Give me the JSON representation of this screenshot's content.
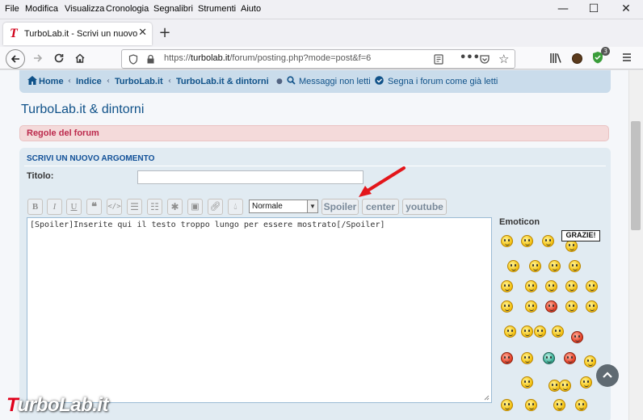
{
  "menu": {
    "items": [
      "File",
      "Modifica",
      "Visualizza",
      "Cronologia",
      "Segnalibri",
      "Strumenti",
      "Aiuto"
    ],
    "window_controls": {
      "minimize": "—",
      "maximize": "☐",
      "close": "✕"
    }
  },
  "tab": {
    "title": "TurboLab.it - Scrivi un nuovo a",
    "logo": "T",
    "close": "✕",
    "new_tab": "+"
  },
  "address": {
    "url_prefix": "https://",
    "url_domain": "turbolab.it",
    "url_path": "/forum/posting.php?mode=post&f=6",
    "badge_count": "3"
  },
  "breadcrumb": {
    "home": "Home",
    "index": "Indice",
    "turbolab": "TurboLab.it",
    "forum": "TurboLab.it & dintorni",
    "unread": "Messaggi non letti",
    "mark_read": "Segna i forum come già letti"
  },
  "forum_title": "TurboLab.it & dintorni",
  "rules_label": "Regole del forum",
  "post_form": {
    "heading": "SCRIVI UN NUOVO ARGOMENTO",
    "subject_label": "Titolo:",
    "subject_value": "",
    "font_size_selected": "Normale",
    "bbcode_spoiler": "Spoiler",
    "bbcode_center": "center",
    "bbcode_youtube": "youtube",
    "message_text": "[Spoiler]Inserite qui il testo troppo lungo per essere mostrato[/Spoiler]",
    "emoticon_heading": "Emoticon",
    "grazie_text": "GRAZIE!"
  },
  "icons": {
    "back": "back-arrow-icon",
    "forward": "forward-arrow-icon",
    "reload": "reload-icon",
    "home": "home-icon"
  },
  "watermark": {
    "brand_T": "T",
    "brand_rest": "urboLab.it"
  },
  "colors": {
    "accent": "#105289",
    "rules_bg": "#f4dada",
    "panel_bg": "#e1ebf2",
    "arrow": "#e3161b"
  }
}
